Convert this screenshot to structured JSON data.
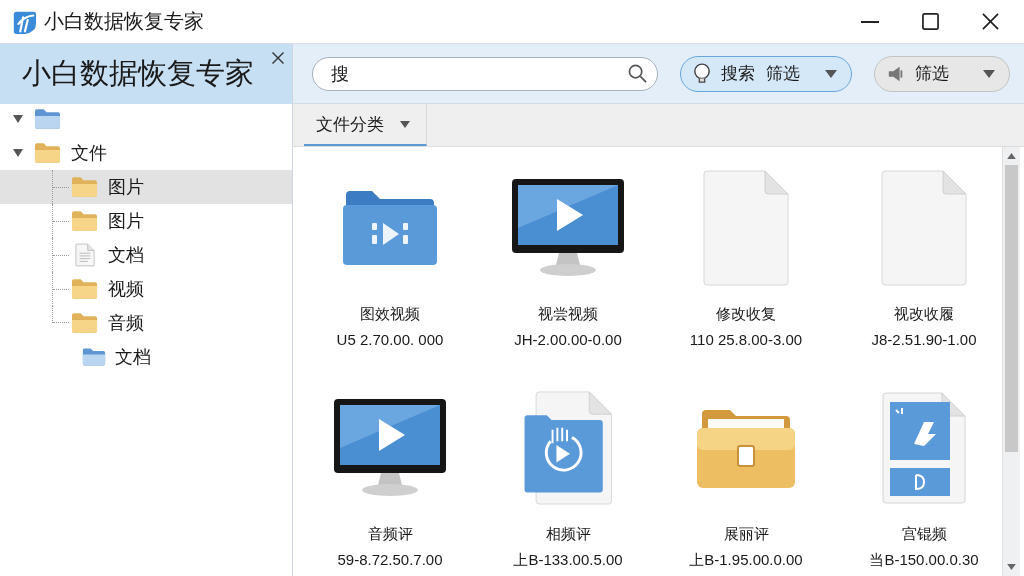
{
  "window": {
    "title": "小白数据恢复专家"
  },
  "sidebar": {
    "title": "小白数据恢复专家",
    "tree": [
      {
        "kind": "blue-folder",
        "expanded": true,
        "selected": false
      },
      {
        "label": "文件",
        "kind": "folder",
        "expanded": true,
        "selected": false,
        "children": [
          {
            "label": "图片",
            "kind": "folder",
            "selected": true
          },
          {
            "label": "图片",
            "kind": "folder",
            "selected": false
          },
          {
            "label": "文档",
            "kind": "document",
            "selected": false
          },
          {
            "label": "视频",
            "kind": "folder",
            "selected": false
          },
          {
            "label": "音频",
            "kind": "folder",
            "selected": false,
            "children": [
              {
                "label": "文档",
                "kind": "blue-folder",
                "selected": false
              }
            ]
          }
        ]
      }
    ]
  },
  "toolbar": {
    "search": {
      "value": "搜"
    },
    "buttons": [
      {
        "label": "搜索 筛选",
        "kind": "primary"
      },
      {
        "label": "筛选",
        "kind": "secondary"
      }
    ]
  },
  "tabs": [
    {
      "label": "文件分类",
      "selected": true
    }
  ],
  "files": [
    {
      "name": "图效视频",
      "size": "U5 2.70.00. 000",
      "kind": "media-folder"
    },
    {
      "name": "视尝视频",
      "size": "JH-2.00.00-0.00",
      "kind": "monitor"
    },
    {
      "name": "修改收复",
      "size": "110 25.8.00-3.00",
      "kind": "file"
    },
    {
      "name": "视改收履",
      "size": "J8-2.51.90-1.00",
      "kind": "file"
    },
    {
      "name": "音频评",
      "size": "59-8.72.50.7.00",
      "kind": "monitor"
    },
    {
      "name": "相频评",
      "size": "上B-133.00.5.00",
      "kind": "media-file"
    },
    {
      "name": "展丽评",
      "size": "上B-1.95.00.0.00",
      "kind": "briefcase"
    },
    {
      "name": "宫锟频",
      "size": "当B-150.00.0.30",
      "kind": "image-file"
    }
  ]
}
